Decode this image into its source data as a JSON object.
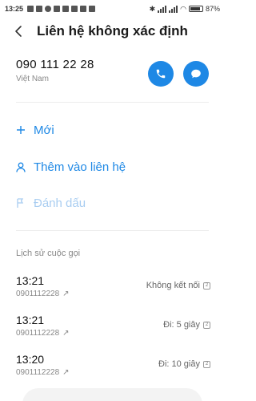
{
  "status_bar": {
    "time": "13:25",
    "battery_percent": "87%",
    "battery_level": 0.87
  },
  "header": {
    "title": "Liên hệ không xác định"
  },
  "contact": {
    "phone_number": "090 111 22 28",
    "region": "Việt Nam"
  },
  "actions": {
    "new_label": "Mới",
    "add_to_contact_label": "Thêm vào liên hệ",
    "mark_label": "Đánh dấu"
  },
  "history": {
    "section_title": "Lịch sử cuộc gọi",
    "entries": [
      {
        "time": "13:21",
        "number": "0901112228",
        "status": "Không kết nối",
        "sim": "2"
      },
      {
        "time": "13:21",
        "number": "0901112228",
        "status": "Đi: 5 giây",
        "sim": "2"
      },
      {
        "time": "13:20",
        "number": "0901112228",
        "status": "Đi: 10 giây",
        "sim": "2"
      }
    ]
  },
  "colors": {
    "accent": "#1e88e5",
    "accent_disabled": "#a9cdf1",
    "text_primary": "#111111",
    "text_secondary": "#888888"
  }
}
